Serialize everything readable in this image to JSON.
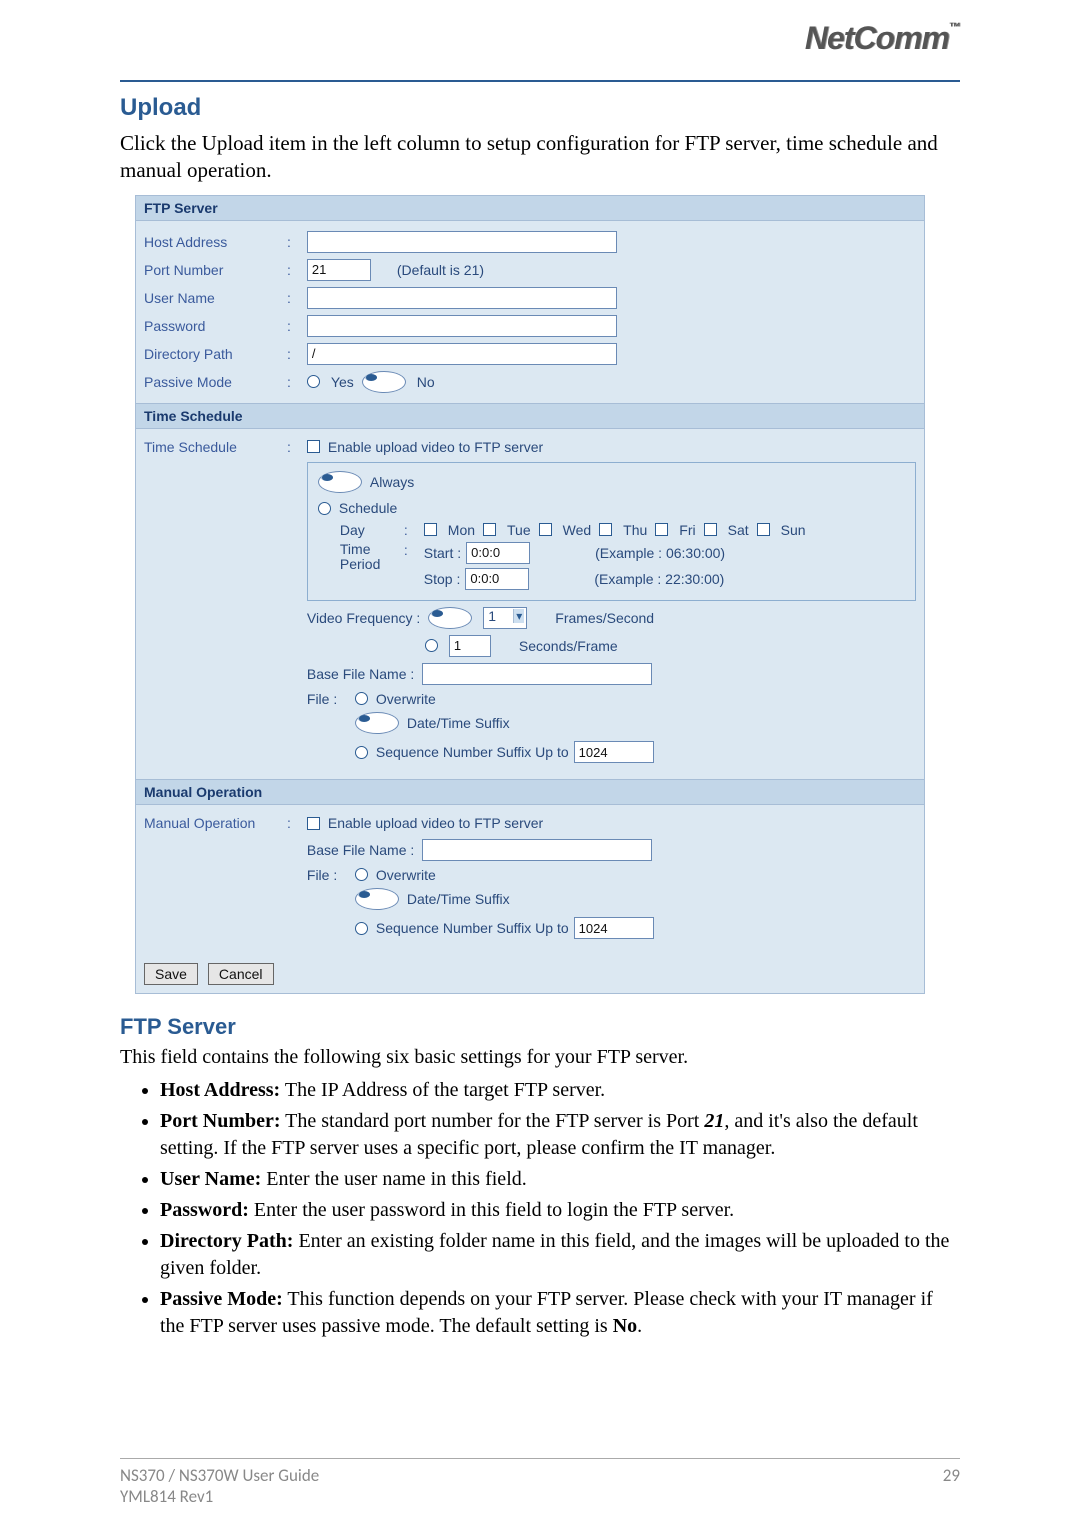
{
  "brand": {
    "name": "NetComm",
    "tm": "™"
  },
  "heading": "Upload",
  "intro": "Click the Upload item in the left column to setup configuration for FTP server, time schedule and manual operation.",
  "ftp": {
    "band": "FTP Server",
    "host_lbl": "Host Address",
    "port_lbl": "Port Number",
    "port_val": "21",
    "port_hint": "(Default is 21)",
    "user_lbl": "User Name",
    "pass_lbl": "Password",
    "dir_lbl": "Directory Path",
    "dir_val": "/",
    "passive_lbl": "Passive Mode",
    "yes": "Yes",
    "no": "No"
  },
  "ts": {
    "band": "Time Schedule",
    "lbl": "Time Schedule",
    "enable": "Enable upload video to FTP server",
    "always": "Always",
    "schedule": "Schedule",
    "day": "Day",
    "days": {
      "mon": "Mon",
      "tue": "Tue",
      "wed": "Wed",
      "thu": "Thu",
      "fri": "Fri",
      "sat": "Sat",
      "sun": "Sun"
    },
    "tp": "Time Period",
    "start": "Start :",
    "stop": "Stop :",
    "start_val": "0:0:0",
    "stop_val": "0:0:0",
    "start_ex": "(Example : 06:30:00)",
    "stop_ex": "(Example : 22:30:00)",
    "vf": "Video Frequency :",
    "vf_sel": "1",
    "fps": "Frames/Second",
    "spf_val": "1",
    "spf": "Seconds/Frame",
    "bfn": "Base File Name :",
    "file": "File :",
    "ow": "Overwrite",
    "dt": "Date/Time Suffix",
    "seq": "Sequence Number Suffix Up to",
    "seq_val": "1024"
  },
  "mo": {
    "band": "Manual Operation",
    "lbl": "Manual Operation",
    "enable": "Enable upload video to FTP server",
    "bfn": "Base File Name :",
    "file": "File :",
    "ow": "Overwrite",
    "dt": "Date/Time Suffix",
    "seq": "Sequence Number Suffix Up to",
    "seq_val": "1024"
  },
  "buttons": {
    "save": "Save",
    "cancel": "Cancel"
  },
  "sub_heading": "FTP Server",
  "sub_intro": "This field contains the following six basic settings for your FTP server.",
  "bullets": {
    "b1a": "Host Address:",
    "b1b": " The IP Address of the target FTP server.",
    "b2a": "Port Number:",
    "b2b": " The standard port number for the FTP server is Port ",
    "b2c": "21",
    "b2d": ", and it's also the default setting.  If the FTP server uses a specific port, please confirm the IT manager.",
    "b3a": "User Name:",
    "b3b": " Enter the user name in this field.",
    "b4a": "Password:",
    "b4b": " Enter the user password in this field to login the FTP server.",
    "b5a": "Directory Path:",
    "b5b": " Enter an existing folder name in this field, and the images will be uploaded to the given folder.",
    "b6a": "Passive Mode:",
    "b6b": " This function depends on your FTP server.  Please check with your IT manager if the FTP server uses passive mode.  The default setting is ",
    "b6c": "No",
    "b6d": "."
  },
  "footer": {
    "l1": "NS370 / NS370W User Guide",
    "l2": "YML814 Rev1",
    "page": "29"
  }
}
